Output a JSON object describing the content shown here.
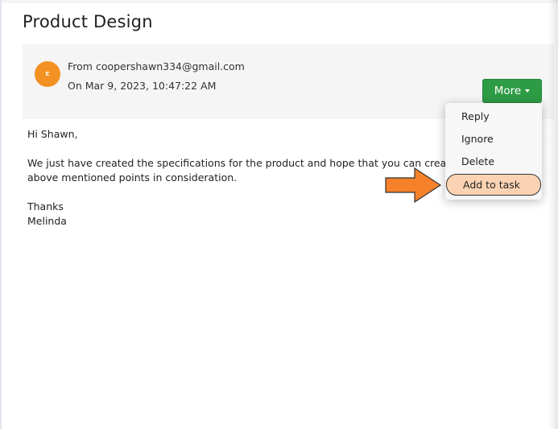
{
  "email": {
    "subject": "Product Design",
    "avatar_initial": "c",
    "from": "From coopershawn334@gmail.com",
    "date": "On Mar 9, 2023, 10:47:22 AM",
    "more_label": "More",
    "body": {
      "greeting": "Hi Shawn,",
      "line1": "We just have created the specifications for the product and hope that you can create a",
      "line2": "above mentioned points in consideration.",
      "signoff": "Thanks",
      "signature": "Melinda"
    }
  },
  "dropdown": {
    "items": [
      "Reply",
      "Ignore",
      "Delete",
      "Add to task"
    ],
    "highlighted_index": 3
  },
  "colors": {
    "avatar": "#f39222",
    "more_button": "#2e9b45",
    "highlight_fill": "#fbd3b3",
    "arrow": "#f5812b"
  },
  "icons": {
    "more_caret": "caret-down-icon",
    "pointer_arrow": "arrow-right-icon"
  }
}
